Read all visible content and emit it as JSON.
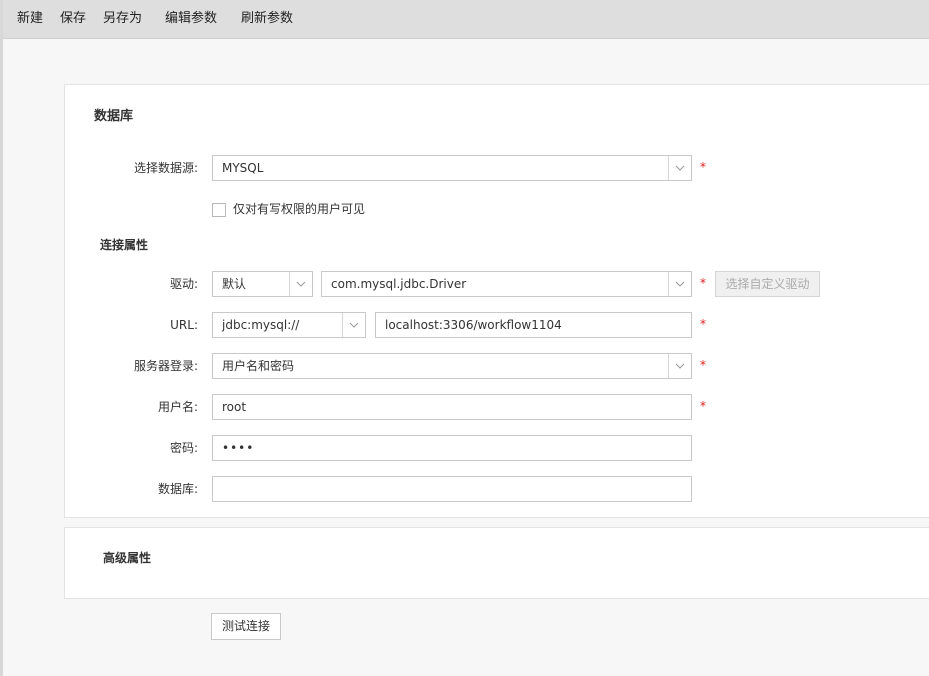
{
  "toolbar": {
    "new_label": "新建",
    "save_label": "保存",
    "save_as_label": "另存为",
    "edit_params_label": "编辑参数",
    "refresh_params_label": "刷新参数"
  },
  "database_section": {
    "title": "数据库",
    "datasource_label": "选择数据源:",
    "datasource_value": "MYSQL",
    "write_only_checkbox_label": "仅对有写权限的用户可见"
  },
  "connection": {
    "title": "连接属性",
    "driver_label": "驱动:",
    "driver_mode": "默认",
    "driver_class": "com.mysql.jdbc.Driver",
    "custom_driver_button": "选择自定义驱动",
    "url_label": "URL:",
    "url_prefix": "jdbc:mysql://",
    "url_value": "localhost:3306/workflow1104",
    "login_label": "服务器登录:",
    "login_value": "用户名和密码",
    "username_label": "用户名:",
    "username_value": "root",
    "password_label": "密码:",
    "password_value": "••••",
    "database_label": "数据库:",
    "database_value": ""
  },
  "advanced": {
    "title": "高级属性"
  },
  "test_button": "测试连接",
  "required_mark": "*",
  "colors": {
    "toolbar_bg": "#dedede",
    "required": "#e02020",
    "border": "#c9c9c9"
  }
}
